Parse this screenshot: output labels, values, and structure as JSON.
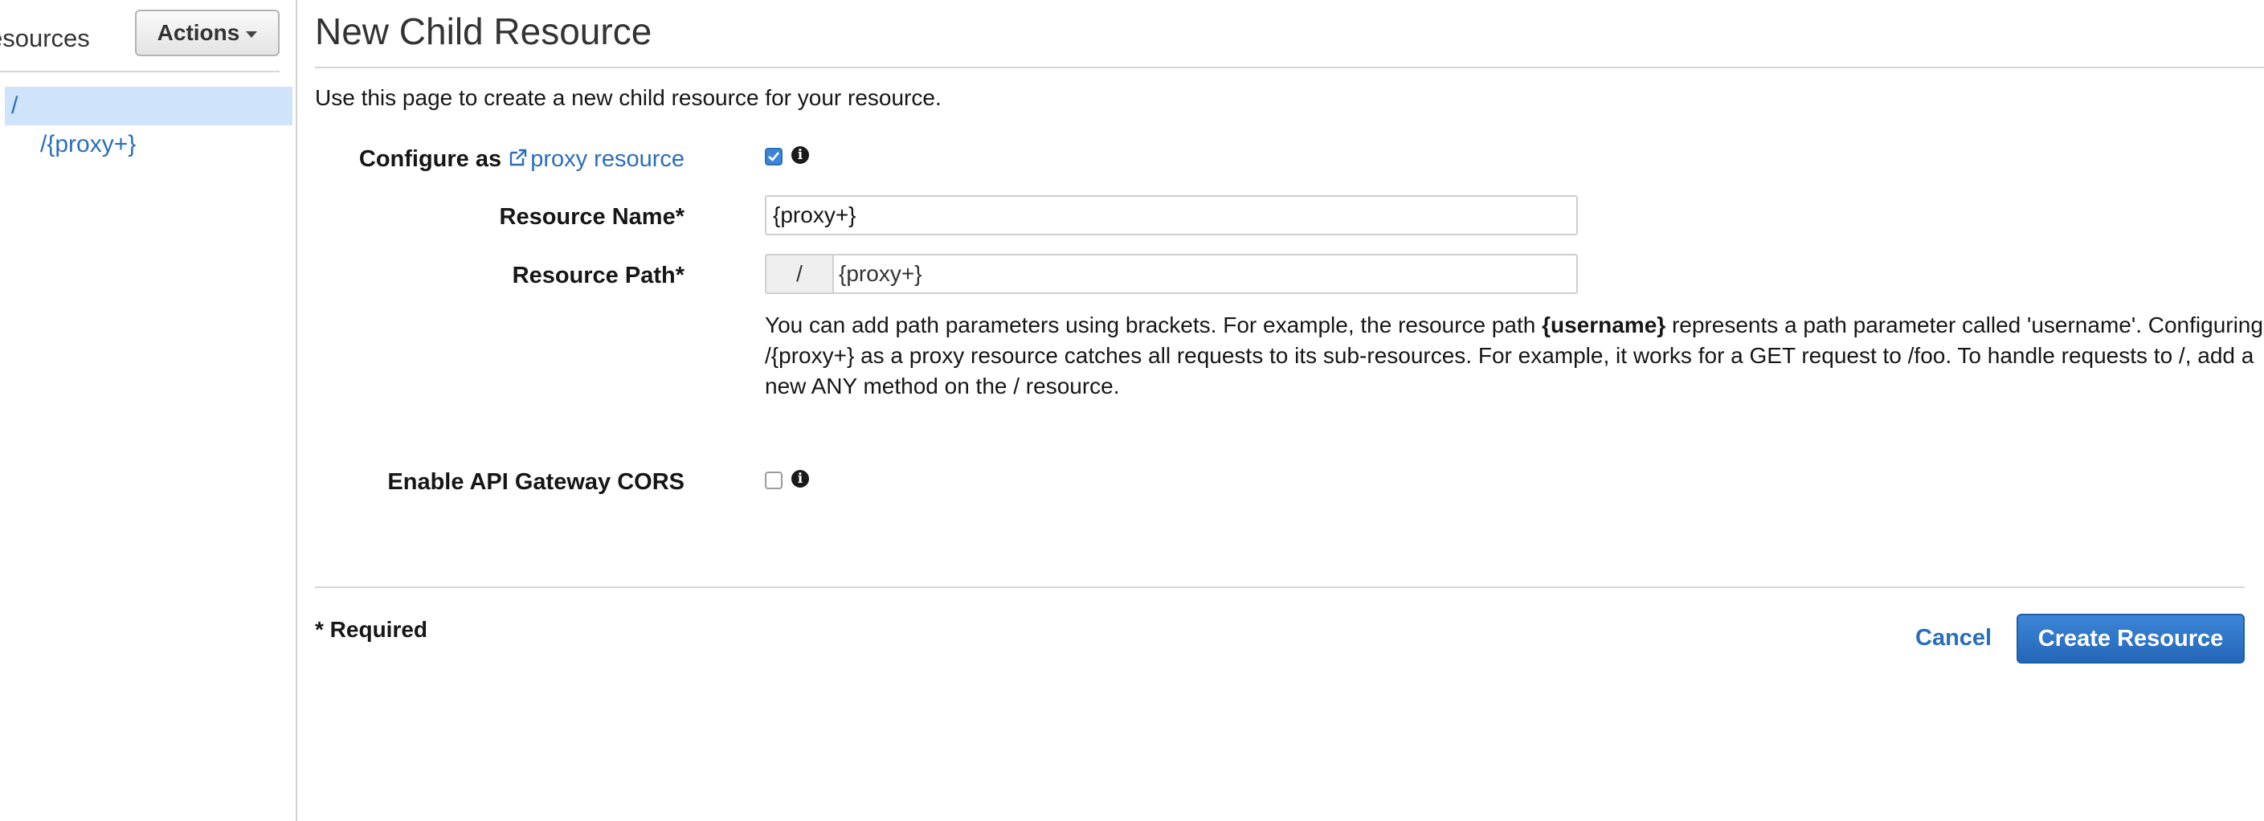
{
  "sidebar": {
    "title": "esources",
    "actions_label": "Actions",
    "tree": [
      {
        "label": "/"
      },
      {
        "label": "/{proxy+}"
      }
    ]
  },
  "main": {
    "title": "New Child Resource",
    "intro": "Use this page to create a new child resource for your resource.",
    "configure": {
      "label_prefix": "Configure as",
      "link_text": "proxy resource",
      "checked": true
    },
    "resource_name": {
      "label": "Resource Name*",
      "value": "{proxy+}"
    },
    "resource_path": {
      "label": "Resource Path*",
      "prefix": "/",
      "value": "{proxy+}"
    },
    "help": {
      "part1": "You can add path parameters using brackets. For example, the resource path ",
      "bold": "{username}",
      "part2": " represents a path parameter called 'username'. Configuring /{proxy+} as a proxy resource catches all requests to its sub-resources. For example, it works for a GET request to /foo. To handle requests to /, add a new ANY method on the / resource."
    },
    "cors": {
      "label": "Enable API Gateway CORS",
      "checked": false
    },
    "footer": {
      "required_note": "* Required",
      "cancel_label": "Cancel",
      "create_label": "Create Resource"
    }
  },
  "colors": {
    "link": "#2a6ebb",
    "selected_row": "#cfe3fb",
    "primary_button": "#2466b7"
  }
}
